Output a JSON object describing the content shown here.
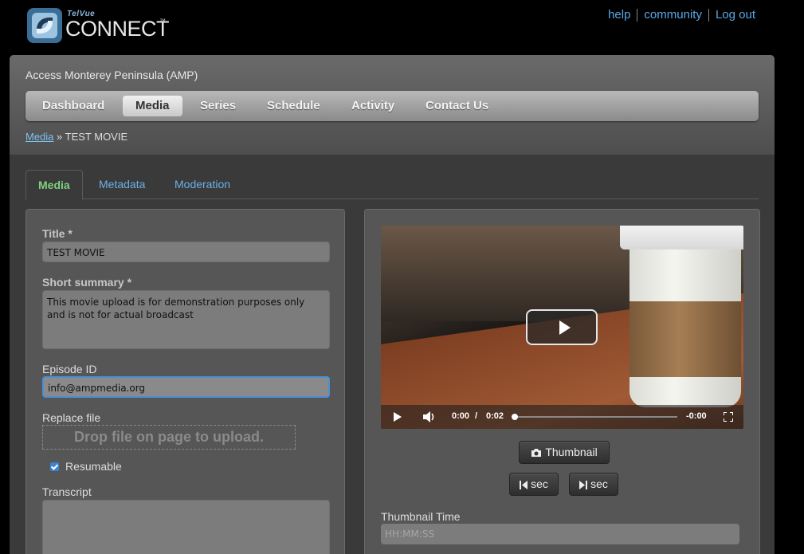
{
  "header": {
    "logo_small": "TelVue",
    "logo_text": "CONNECT",
    "logo_tm": "™",
    "links": [
      "help",
      "community",
      "Log out"
    ]
  },
  "station": "Access Monterey Peninsula (AMP)",
  "nav": [
    "Dashboard",
    "Media",
    "Series",
    "Schedule",
    "Activity",
    "Contact Us"
  ],
  "nav_active": "Media",
  "breadcrumb": {
    "link": "Media",
    "sep": " » ",
    "current": "TEST MOVIE"
  },
  "tabs": [
    "Media",
    "Metadata",
    "Moderation"
  ],
  "form": {
    "title_label": "Title *",
    "title_value": "TEST MOVIE",
    "summary_label": "Short summary *",
    "summary_value": "This movie upload is for demonstration purposes only and is not for actual broadcast",
    "episode_label": "Episode ID",
    "episode_value": "info@ampmedia.org",
    "replace_label": "Replace file",
    "dropzone": "Drop file on page to upload.",
    "resumable_label": "Resumable",
    "resumable_checked": true,
    "transcript_label": "Transcript",
    "transcript_value": ""
  },
  "video": {
    "current_time": "0:00",
    "time_sep": "/",
    "duration": "0:02",
    "remaining": "-0:00",
    "progress": 0
  },
  "thumbnail": {
    "button": "Thumbnail",
    "back_button": "sec",
    "forward_button": "sec",
    "time_label": "Thumbnail Time",
    "time_placeholder": "HH:MM:SS"
  }
}
